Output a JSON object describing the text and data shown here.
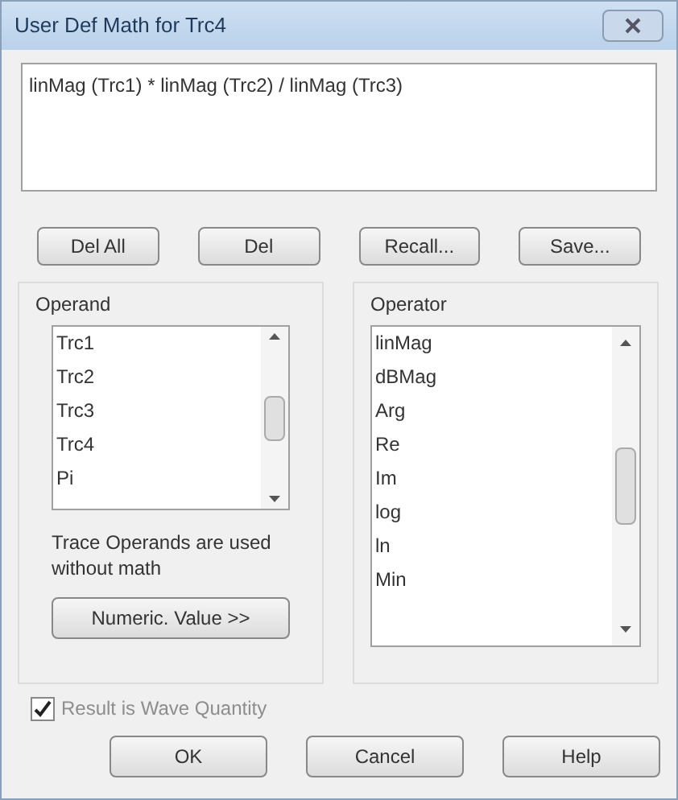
{
  "window": {
    "title": "User Def Math for Trc4"
  },
  "formula": {
    "value": "linMag (Trc1) * linMag (Trc2) / linMag (Trc3)"
  },
  "edit_buttons": [
    "Del All",
    "Del",
    "Recall...",
    "Save..."
  ],
  "operand": {
    "label": "Operand",
    "items": [
      "Trc1",
      "Trc2",
      "Trc3",
      "Trc4",
      "Pi"
    ],
    "note": "Trace Operands are used without math",
    "button": "Numeric. Value >>"
  },
  "operator": {
    "label": "Operator",
    "items": [
      "linMag",
      "dBMag",
      "Arg",
      "Re",
      "Im",
      "log",
      "ln",
      "Min"
    ]
  },
  "result_checkbox": {
    "label": "Result is Wave Quantity",
    "checked": true,
    "disabled": true
  },
  "buttons": [
    "OK",
    "Cancel",
    "Help"
  ]
}
